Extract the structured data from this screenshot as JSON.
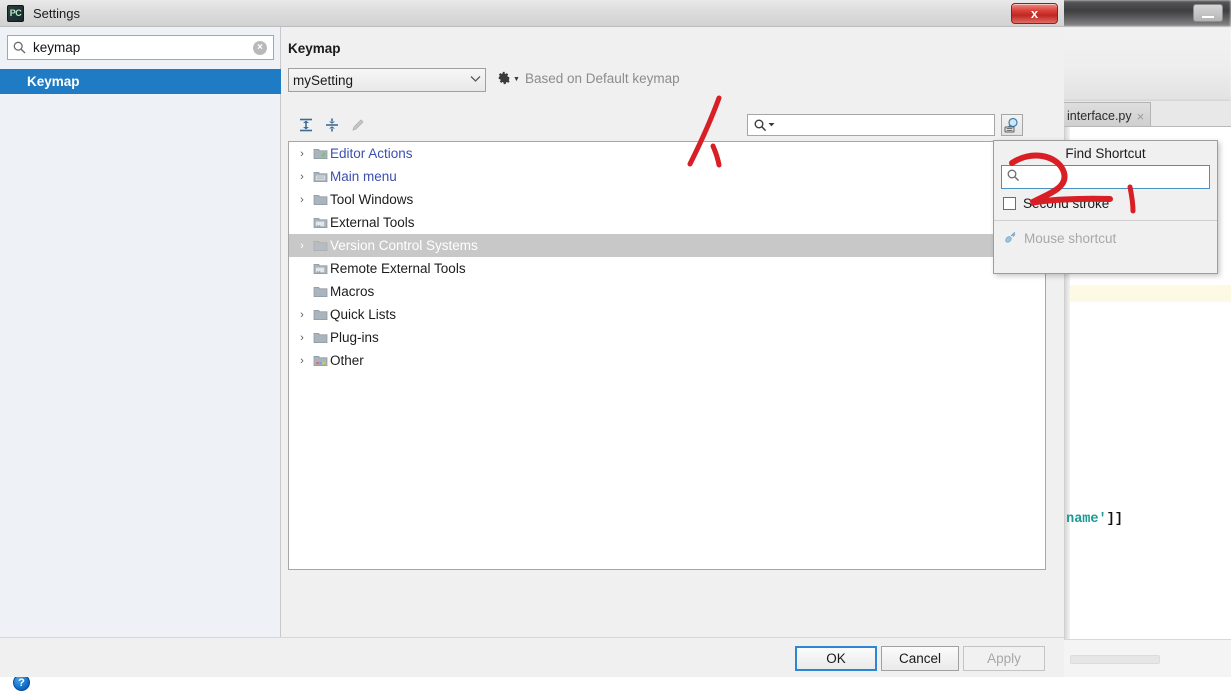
{
  "ide": {
    "editor_tab": {
      "label": "interface.py",
      "close_icon": "close-icon"
    },
    "code_fragment": {
      "string_part": "'name'",
      "punct_part": "]]"
    },
    "minimize_icon": "minimize-icon"
  },
  "dialog": {
    "title": "Settings",
    "app_icon_label": "PC",
    "close_icon": "close-icon",
    "close_label": "x"
  },
  "left_panel": {
    "search": {
      "value": "keymap",
      "placeholder": "",
      "search_icon": "search-icon",
      "clear_icon": "clear-icon",
      "clear_label": "×"
    },
    "tree_items": [
      {
        "label": "Keymap",
        "selected": true
      }
    ],
    "help_button_label": "?"
  },
  "right_pane": {
    "heading": "Keymap",
    "scheme": {
      "value": "mySetting",
      "arrow": "▼"
    },
    "gear_icon": "gear-icon",
    "gear_arrow": "▼",
    "based_on": "Based on Default keymap",
    "toolbar": {
      "expand_all_icon": "expand-all-icon",
      "collapse_all_icon": "collapse-all-icon",
      "edit_icon": "edit-pencil-icon"
    },
    "filter": {
      "value": "",
      "placeholder": "",
      "search_icon": "search-icon",
      "dropdown_arrow": "▼"
    },
    "find_shortcut_button_icon": "find-shortcut-icon",
    "tree_rows": [
      {
        "label": "Editor Actions",
        "expandable": true,
        "link": true,
        "selected": false,
        "icon": "folder-editor-icon"
      },
      {
        "label": "Main menu",
        "expandable": true,
        "link": true,
        "selected": false,
        "icon": "folder-menu-icon"
      },
      {
        "label": "Tool Windows",
        "expandable": true,
        "link": false,
        "selected": false,
        "icon": "folder-icon"
      },
      {
        "label": "External Tools",
        "expandable": false,
        "link": false,
        "selected": false,
        "icon": "folder-tools-icon"
      },
      {
        "label": "Version Control Systems",
        "expandable": true,
        "link": false,
        "selected": true,
        "icon": "folder-icon"
      },
      {
        "label": "Remote External Tools",
        "expandable": false,
        "link": false,
        "selected": false,
        "icon": "folder-tools-icon"
      },
      {
        "label": "Macros",
        "expandable": false,
        "link": false,
        "selected": false,
        "icon": "folder-icon"
      },
      {
        "label": "Quick Lists",
        "expandable": true,
        "link": false,
        "selected": false,
        "icon": "folder-icon"
      },
      {
        "label": "Plug-ins",
        "expandable": true,
        "link": false,
        "selected": false,
        "icon": "folder-icon"
      },
      {
        "label": "Other",
        "expandable": true,
        "link": false,
        "selected": false,
        "icon": "folder-other-icon"
      }
    ]
  },
  "find_shortcut_popup": {
    "title": "Find Shortcut",
    "input": {
      "value": "",
      "placeholder": "",
      "search_icon": "search-icon"
    },
    "second_stroke_label": "Second stroke",
    "second_stroke_checked": false,
    "mouse_shortcut_label": "Mouse shortcut",
    "mouse_shortcut_icon": "mouse-icon",
    "mouse_shortcut_enabled": false
  },
  "buttons": {
    "ok": "OK",
    "cancel": "Cancel",
    "apply": "Apply"
  },
  "annotations": {
    "color": "#d81f26",
    "marks": [
      {
        "name": "annotation-1",
        "text": "1"
      },
      {
        "name": "annotation-2",
        "text": "2"
      }
    ]
  },
  "colors": {
    "accent_blue": "#1f7cc4",
    "link_blue": "#3c4fb0",
    "selection_gray": "#c8c8c8",
    "annotation_red": "#d81f26",
    "close_red": "#bf2722"
  }
}
